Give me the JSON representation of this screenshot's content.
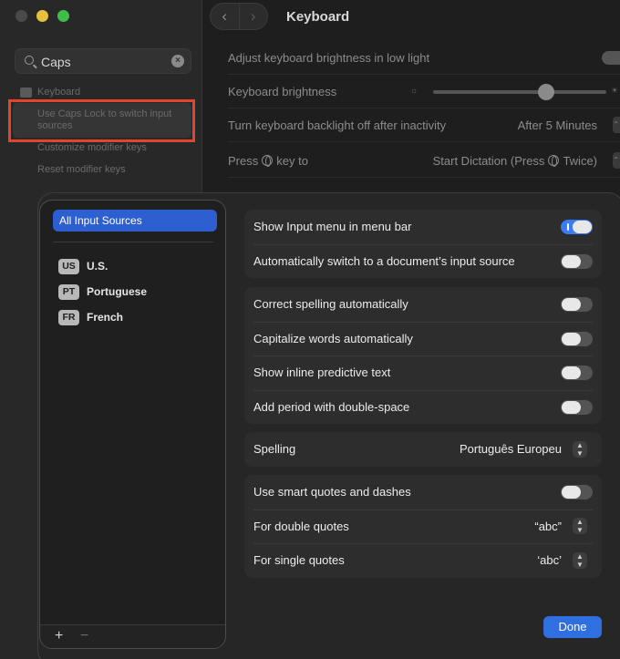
{
  "window": {
    "title": "Keyboard"
  },
  "sidebar": {
    "search_value": "Caps",
    "section_label": "Keyboard",
    "results": [
      {
        "label": "Use Caps Lock to switch input sources"
      },
      {
        "label": "Customize modifier keys"
      },
      {
        "label": "Reset modifier keys"
      }
    ]
  },
  "keyboard_settings": {
    "rows": [
      {
        "label": "Adjust keyboard brightness in low light"
      },
      {
        "label": "Keyboard brightness"
      },
      {
        "label": "Turn keyboard backlight off after inactivity",
        "value": "After 5 Minutes"
      },
      {
        "label_pre": "Press",
        "label_post": "key to",
        "value_pre": "Start Dictation (Press",
        "value_post": "Twice)"
      }
    ]
  },
  "input_sources": {
    "all_label": "All Input Sources",
    "items": [
      {
        "code": "US",
        "name": "U.S."
      },
      {
        "code": "PT",
        "name": "Portuguese"
      },
      {
        "code": "FR",
        "name": "French"
      }
    ],
    "add_symbol": "+",
    "remove_symbol": "−"
  },
  "settings": {
    "menu": [
      {
        "label": "Show Input menu in menu bar",
        "on": true
      },
      {
        "label": "Automatically switch to a document’s input source",
        "on": false
      }
    ],
    "text": [
      {
        "label": "Correct spelling automatically",
        "on": false
      },
      {
        "label": "Capitalize words automatically",
        "on": false
      },
      {
        "label": "Show inline predictive text",
        "on": false
      },
      {
        "label": "Add period with double-space",
        "on": false
      }
    ],
    "spelling": {
      "label": "Spelling",
      "value": "Português Europeu"
    },
    "quotes": {
      "smart_label": "Use smart quotes and dashes",
      "smart_on": false,
      "double_label": "For double quotes",
      "double_value": "“abc”",
      "single_label": "For single quotes",
      "single_value": "‘abc’"
    }
  },
  "done_label": "Done",
  "colors": {
    "accent": "#2f6fdf",
    "selection": "#2e5fd1",
    "highlight_box": "#e4442d"
  }
}
